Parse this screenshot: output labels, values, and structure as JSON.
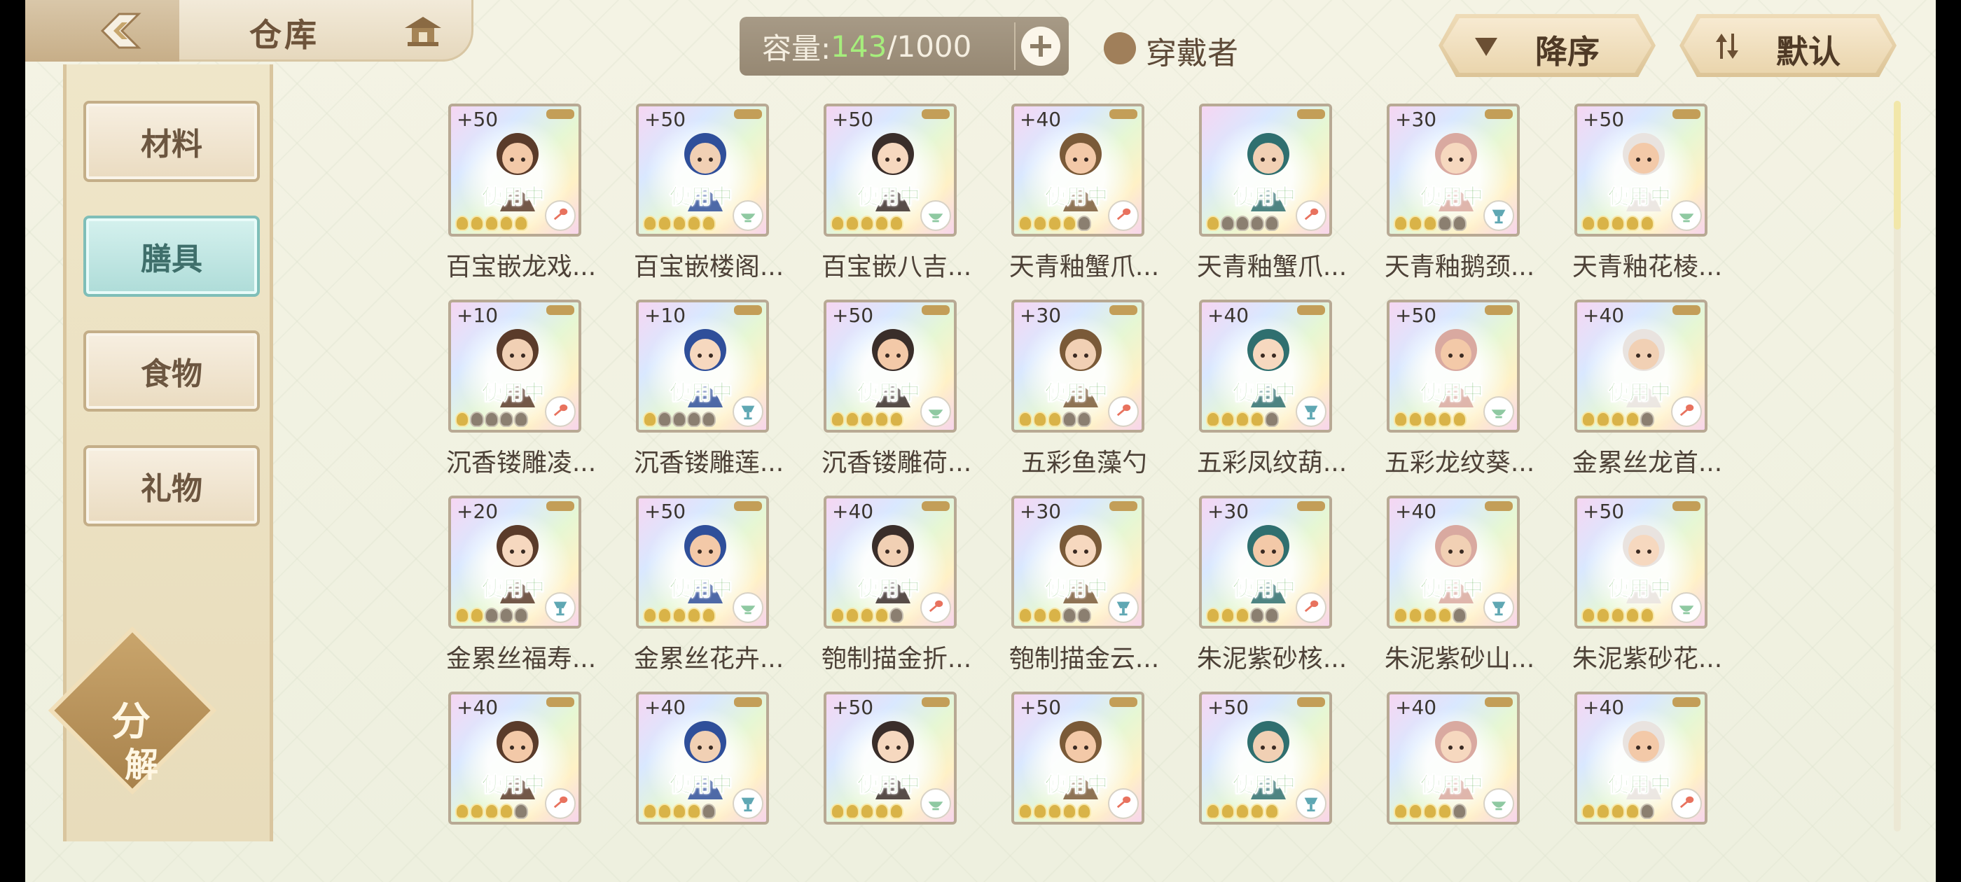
{
  "header": {
    "title": "仓库",
    "capacity_label": "容量:",
    "capacity_current": "143",
    "capacity_slash": "/",
    "capacity_max": "1000",
    "wearer_label": "穿戴者",
    "sort_label": "降序",
    "default_label": "默认"
  },
  "sidebar": {
    "tabs": [
      {
        "label": "材料",
        "active": false
      },
      {
        "label": "膳具",
        "active": true
      },
      {
        "label": "食物",
        "active": false
      },
      {
        "label": "礼物",
        "active": false
      }
    ],
    "decompose_line1": "分",
    "decompose_line2": "解"
  },
  "items": [
    {
      "plus": "+50",
      "name": "百宝嵌龙戏...",
      "stars_on": 5,
      "type": "spoon-icon"
    },
    {
      "plus": "+50",
      "name": "百宝嵌楼阁...",
      "stars_on": 5,
      "type": "bowl-icon"
    },
    {
      "plus": "+50",
      "name": "百宝嵌八吉...",
      "stars_on": 5,
      "type": "bowl-icon"
    },
    {
      "plus": "+40",
      "name": "天青釉蟹爪...",
      "stars_on": 4,
      "type": "spoon-icon"
    },
    {
      "plus": "",
      "name": "天青釉蟹爪...",
      "stars_on": 1,
      "type": "spoon-icon"
    },
    {
      "plus": "+30",
      "name": "天青釉鹅颈...",
      "stars_on": 3,
      "type": "cup-icon"
    },
    {
      "plus": "+50",
      "name": "天青釉花棱...",
      "stars_on": 5,
      "type": "bowl-icon"
    },
    {
      "plus": "+10",
      "name": "沉香镂雕凌...",
      "stars_on": 1,
      "type": "spoon-icon"
    },
    {
      "plus": "+10",
      "name": "沉香镂雕莲...",
      "stars_on": 1,
      "type": "cup-icon"
    },
    {
      "plus": "+50",
      "name": "沉香镂雕荷...",
      "stars_on": 5,
      "type": "bowl-icon"
    },
    {
      "plus": "+30",
      "name": "五彩鱼藻勺",
      "stars_on": 3,
      "type": "spoon-icon"
    },
    {
      "plus": "+40",
      "name": "五彩凤纹葫...",
      "stars_on": 4,
      "type": "cup-icon"
    },
    {
      "plus": "+50",
      "name": "五彩龙纹葵...",
      "stars_on": 5,
      "type": "bowl-icon"
    },
    {
      "plus": "+40",
      "name": "金累丝龙首...",
      "stars_on": 4,
      "type": "spoon-icon"
    },
    {
      "plus": "+20",
      "name": "金累丝福寿...",
      "stars_on": 2,
      "type": "cup-icon"
    },
    {
      "plus": "+50",
      "name": "金累丝花卉...",
      "stars_on": 5,
      "type": "bowl-icon"
    },
    {
      "plus": "+40",
      "name": "匏制描金折...",
      "stars_on": 4,
      "type": "spoon-icon"
    },
    {
      "plus": "+30",
      "name": "匏制描金云...",
      "stars_on": 3,
      "type": "cup-icon"
    },
    {
      "plus": "+30",
      "name": "朱泥紫砂核...",
      "stars_on": 3,
      "type": "spoon-icon"
    },
    {
      "plus": "+40",
      "name": "朱泥紫砂山...",
      "stars_on": 4,
      "type": "cup-icon"
    },
    {
      "plus": "+50",
      "name": "朱泥紫砂花...",
      "stars_on": 5,
      "type": "bowl-icon"
    },
    {
      "plus": "+40",
      "name": "",
      "stars_on": 4,
      "type": "spoon-icon"
    },
    {
      "plus": "+40",
      "name": "",
      "stars_on": 4,
      "type": "cup-icon"
    },
    {
      "plus": "+50",
      "name": "",
      "stars_on": 5,
      "type": "bowl-icon"
    },
    {
      "plus": "+50",
      "name": "",
      "stars_on": 5,
      "type": "spoon-icon"
    },
    {
      "plus": "+50",
      "name": "",
      "stars_on": 5,
      "type": "cup-icon"
    },
    {
      "plus": "+40",
      "name": "",
      "stars_on": 4,
      "type": "bowl-icon"
    },
    {
      "plus": "+40",
      "name": "",
      "stars_on": 4,
      "type": "spoon-icon"
    }
  ],
  "in_use_label": "使用中",
  "colors": {
    "in_use": "#4aa33a",
    "capacity_current": "#a6ee7c",
    "active_tab": "#aedcd8"
  }
}
